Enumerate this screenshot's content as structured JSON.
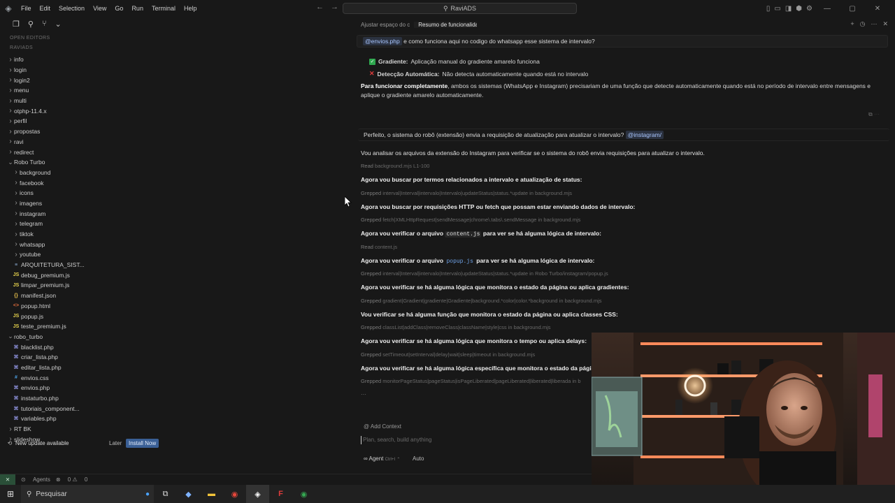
{
  "titlebar": {
    "menu": [
      "File",
      "Edit",
      "Selection",
      "View",
      "Go",
      "Run",
      "Terminal",
      "Help"
    ],
    "search": "RaviADS"
  },
  "sidebar": {
    "open_editors_label": "OPEN EDITORS",
    "workspace_label": "RAVIADS",
    "tree": [
      {
        "label": "info",
        "level": 0,
        "kind": "folder",
        "open": false
      },
      {
        "label": "login",
        "level": 0,
        "kind": "folder",
        "open": false
      },
      {
        "label": "login2",
        "level": 0,
        "kind": "folder",
        "open": false
      },
      {
        "label": "menu",
        "level": 0,
        "kind": "folder",
        "open": false
      },
      {
        "label": "multi",
        "level": 0,
        "kind": "folder",
        "open": false
      },
      {
        "label": "otphp-11.4.x",
        "level": 0,
        "kind": "folder",
        "open": false
      },
      {
        "label": "perfil",
        "level": 0,
        "kind": "folder",
        "open": false
      },
      {
        "label": "propostas",
        "level": 0,
        "kind": "folder",
        "open": false
      },
      {
        "label": "ravi",
        "level": 0,
        "kind": "folder",
        "open": false
      },
      {
        "label": "redirect",
        "level": 0,
        "kind": "folder",
        "open": false
      },
      {
        "label": "Robo Turbo",
        "level": 0,
        "kind": "folder",
        "open": true
      },
      {
        "label": "background",
        "level": 1,
        "kind": "folder",
        "open": false
      },
      {
        "label": "facebook",
        "level": 1,
        "kind": "folder",
        "open": false
      },
      {
        "label": "icons",
        "level": 1,
        "kind": "folder",
        "open": false
      },
      {
        "label": "imagens",
        "level": 1,
        "kind": "folder",
        "open": false
      },
      {
        "label": "instagram",
        "level": 1,
        "kind": "folder",
        "open": false
      },
      {
        "label": "telegram",
        "level": 1,
        "kind": "folder",
        "open": false
      },
      {
        "label": "tiktok",
        "level": 1,
        "kind": "folder",
        "open": false
      },
      {
        "label": "whatsapp",
        "level": 1,
        "kind": "folder",
        "open": false
      },
      {
        "label": "youtube",
        "level": 1,
        "kind": "folder",
        "open": false
      },
      {
        "label": "ARQUITETURA_SIST...",
        "level": 1,
        "kind": "md",
        "open": false
      },
      {
        "label": "debug_premium.js",
        "level": 1,
        "kind": "js",
        "open": false
      },
      {
        "label": "limpar_premium.js",
        "level": 1,
        "kind": "js",
        "open": false
      },
      {
        "label": "manifest.json",
        "level": 1,
        "kind": "json",
        "open": false
      },
      {
        "label": "popup.html",
        "level": 1,
        "kind": "html",
        "open": false
      },
      {
        "label": "popup.js",
        "level": 1,
        "kind": "js",
        "open": false
      },
      {
        "label": "teste_premium.js",
        "level": 1,
        "kind": "js",
        "open": false
      },
      {
        "label": "robo_turbo",
        "level": 0,
        "kind": "folder",
        "open": true
      },
      {
        "label": "blacklist.php",
        "level": 1,
        "kind": "php",
        "open": false
      },
      {
        "label": "criar_lista.php",
        "level": 1,
        "kind": "php",
        "open": false
      },
      {
        "label": "editar_lista.php",
        "level": 1,
        "kind": "php",
        "open": false
      },
      {
        "label": "envios.css",
        "level": 1,
        "kind": "css",
        "open": false
      },
      {
        "label": "envios.php",
        "level": 1,
        "kind": "php",
        "open": false
      },
      {
        "label": "instaturbo.php",
        "level": 1,
        "kind": "php",
        "open": false
      },
      {
        "label": "tutoriais_component...",
        "level": 1,
        "kind": "php",
        "open": false
      },
      {
        "label": "variables.php",
        "level": 1,
        "kind": "php",
        "open": false
      },
      {
        "label": "RT BK",
        "level": 0,
        "kind": "folder",
        "open": false
      },
      {
        "label": "slideshow",
        "level": 0,
        "kind": "folder",
        "open": false
      }
    ],
    "update": {
      "text": "New update available",
      "later": "Later",
      "install": "Install Now"
    }
  },
  "statusbar": {
    "agents": "Agents",
    "problems": "0",
    "warnings": "0"
  },
  "chat": {
    "tabs": [
      "Ajustar espaço do c",
      "Resumo de funcionalidades do sis"
    ],
    "msg1": {
      "mention": "@envios.php",
      "text": "e como funciona aqui no codigo do whatsapp esse sistema de intervalo?"
    },
    "bullet1": {
      "label": "Gradiente:",
      "text": "Aplicação manual do gradiente amarelo funciona"
    },
    "bullet2": {
      "label": "Detecção Automática:",
      "text": "Não detecta automaticamente quando está no intervalo"
    },
    "para_bold": "Para funcionar completamente",
    "para_line1": ", ambos os sistemas (WhatsApp e Instagram) precisariam de uma função que detecte automaticamente quando está no período de intervalo entre mensagens e",
    "para_line2": "aplique o gradiente amarelo automaticamente.",
    "msg2": {
      "text": "Perfeito, o sistema do robô (extensão) envia a requisição de atualização para atualizar o intervalo?",
      "mention": "@instagram/"
    },
    "lines": {
      "l1": "Vou analisar os arquivos da extensão do Instagram para verificar se o sistema do robô envia requisições para atualizar o intervalo.",
      "t1_verb": "Read",
      "t1": "background.mjs L1-100",
      "l2": "Agora vou buscar por termos relacionados a intervalo e atualização de status:",
      "t2_verb": "Grepped",
      "t2": "interval|Interval|intervalo|Intervalo|updateStatus|status.*update in background.mjs",
      "l3": "Agora vou buscar por requisições HTTP ou fetch que possam estar enviando dados de intervalo:",
      "t3_verb": "Grepped",
      "t3": "fetch|XMLHttpRequest|sendMessage|chrome\\.tabs\\.sendMessage in background.mjs",
      "l4a": "Agora vou verificar o arquivo",
      "l4code": "content.js",
      "l4b": "para ver se há alguma lógica de intervalo:",
      "t4_verb": "Read",
      "t4": "content.js",
      "l5a": "Agora vou verificar o arquivo",
      "l5code": "popup.js",
      "l5b": "para ver se há alguma lógica de intervalo:",
      "t5_verb": "Grepped",
      "t5": "interval|Interval|intervalo|Intervalo|updateStatus|status.*update in Robo Turbo/instagram/popup.js",
      "l6": "Agora vou verificar se há alguma lógica que monitora o estado da página ou aplica gradientes:",
      "t6_verb": "Grepped",
      "t6": "gradient|Gradient|gradiente|Gradiente|background.*color|color.*background in background.mjs",
      "l7": "Vou verificar se há alguma função que monitora o estado da página ou aplica classes CSS:",
      "t7_verb": "Grepped",
      "t7": "classList|addClass|removeClass|className|style|css in background.mjs",
      "l8": "Agora vou verificar se há alguma lógica que monitora o tempo ou aplica delays:",
      "t8_verb": "Grepped",
      "t8": "setTimeout|setInterval|delay|wait|sleep|timeout in background.mjs",
      "l9": "Agora vou verificar se há alguma lógica específica que monitora o estado da página ou",
      "t9_verb": "Grepped",
      "t9": "monitorPageStatus|pageStatus|isPageLiberated|pageLiberated|liberated|liberada in b"
    },
    "composer": {
      "context": "@ Add Context",
      "placeholder": "Plan, search, build anything",
      "agent": "∞ Agent",
      "shortcut": "Ctrl+I",
      "mode": "Auto"
    }
  },
  "taskbar": {
    "search": "Pesquisar"
  }
}
